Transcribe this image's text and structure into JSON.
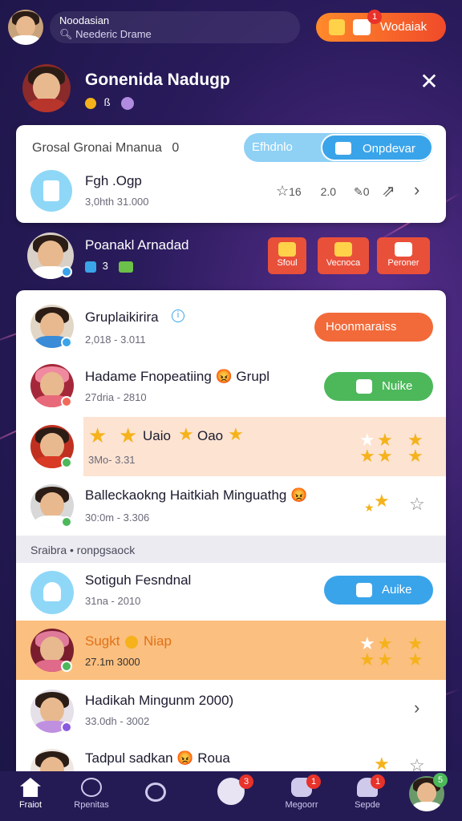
{
  "header": {
    "search_line1": "Noodasian",
    "search_line2": "Neederic Drame",
    "action_label": "Wodaiak",
    "action_badge": "1"
  },
  "profile": {
    "name": "Gonenida Nadugp",
    "meta": "ß",
    "close": "✕"
  },
  "card1": {
    "title": "Grosal Gronai Mnanua",
    "title_count": "0",
    "toggle_left": "Efhdnlo",
    "toggle_right": "Onpdevar",
    "row_title": "Fgh .Ogp",
    "row_sub": "3,0hth  31.000",
    "stat1": "16",
    "stat2": "2.0",
    "stat3": "0"
  },
  "user2": {
    "name": "Poanakl Arnadad",
    "meta": "3",
    "btn1": "Sfoul",
    "btn2": "Vecnoca",
    "btn3": "Peroner"
  },
  "list": [
    {
      "title": "Gruplaikirira",
      "sub": "2,018 - 3.011",
      "action": "Hoonmaraiss"
    },
    {
      "title": "Hadame Fnopeatiing 😡 Grupl",
      "sub": "27dria - 2810",
      "action": "Nuike"
    },
    {
      "title": "Uaio",
      "title2": "Oao",
      "sub": "3Mo- 3.31"
    },
    {
      "title": "Balleckaokng Haitkiah Minguathg 😡",
      "sub": "30:0m - 3.306"
    }
  ],
  "section": "Sraibra • ronpgsaock",
  "list2": [
    {
      "title": "Sotiguh Fesndnal",
      "sub": "31na - 2010",
      "action": "Auike"
    },
    {
      "title": "Sugkt",
      "title2": "Niap",
      "sub": "27.1m  3000"
    },
    {
      "title": "Hadikah Mingunm 2000)",
      "sub": "33.0dh - 3002"
    },
    {
      "title": "Tadpul sadkan 😡 Roua"
    }
  ],
  "nav": [
    {
      "label": "Fraiot",
      "badge": ""
    },
    {
      "label": "Rpenitas",
      "badge": ""
    },
    {
      "label": "",
      "badge": ""
    },
    {
      "label": "",
      "badge": "3"
    },
    {
      "label": "Megoorr",
      "badge": "1"
    },
    {
      "label": "Sepde",
      "badge": "1"
    },
    {
      "label": "",
      "badge": "5"
    }
  ],
  "colors": {
    "orange": "#f26a3a",
    "green": "#4cb85a",
    "blue": "#3aa4ea",
    "highlight_peach": "#fde3d2",
    "highlight_orange": "#fbbf7f"
  }
}
